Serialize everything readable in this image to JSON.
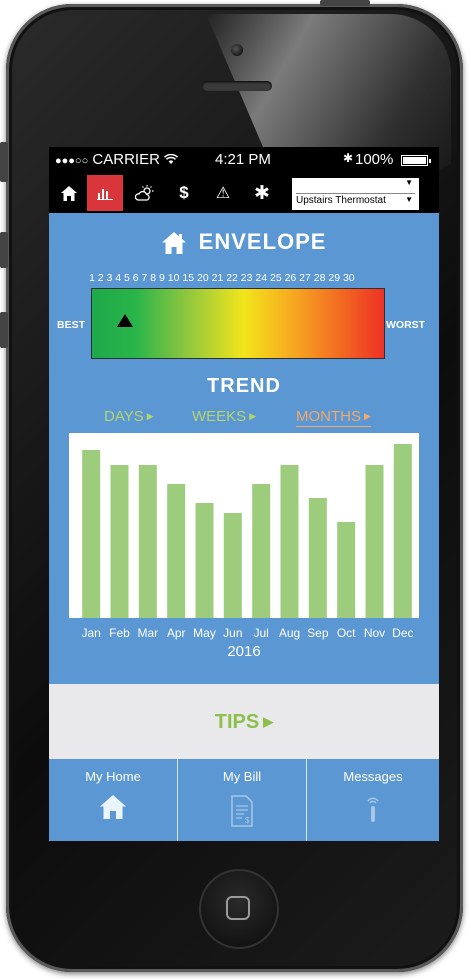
{
  "status_bar": {
    "signal": "●●●○○",
    "carrier": "CARRIER",
    "time": "4:21 PM",
    "bluetooth": "✱",
    "battery": "100%"
  },
  "toolbar": {
    "icons": [
      "home-icon",
      "bar-chart-icon",
      "weather-icon",
      "dollar-icon",
      "warning-icon",
      "gear-icon"
    ],
    "dollar": "$",
    "warning": "⚠",
    "gear": "✱",
    "thermostat_blank": "",
    "thermostat_selected": "Upstairs Thermostat",
    "active_color": "#d8363a"
  },
  "envelope": {
    "title": "ENVELOPE",
    "scale_numbers": "1 2 3 4 5 6 7 8 9 10 15 20 21 22 23 24 25 26 27 28 29 30",
    "best_label": "BEST",
    "worst_label": "WORST",
    "marker_value": 4
  },
  "trend": {
    "title": "TREND",
    "tabs": {
      "days": "DAYS",
      "weeks": "WEEKS",
      "months": "MONTHS"
    },
    "active_tab": "MONTHS",
    "year": "2016",
    "bar_color": "#9ccc7c"
  },
  "chart_data": {
    "type": "bar",
    "categories": [
      "Jan",
      "Feb",
      "Mar",
      "Apr",
      "May",
      "Jun",
      "Jul",
      "Aug",
      "Sep",
      "Oct",
      "Nov",
      "Dec"
    ],
    "values": [
      168,
      153,
      153,
      134,
      115,
      105,
      134,
      153,
      120,
      96,
      153,
      174
    ],
    "xlabel": "2016",
    "ylim": [
      0,
      185
    ],
    "grid": false
  },
  "tips": {
    "label": "TIPS"
  },
  "bottom_nav": {
    "items": [
      {
        "label": "My Home",
        "icon": "home-icon"
      },
      {
        "label": "My Bill",
        "icon": "bill-icon"
      },
      {
        "label": "Messages",
        "icon": "messages-icon"
      }
    ]
  }
}
